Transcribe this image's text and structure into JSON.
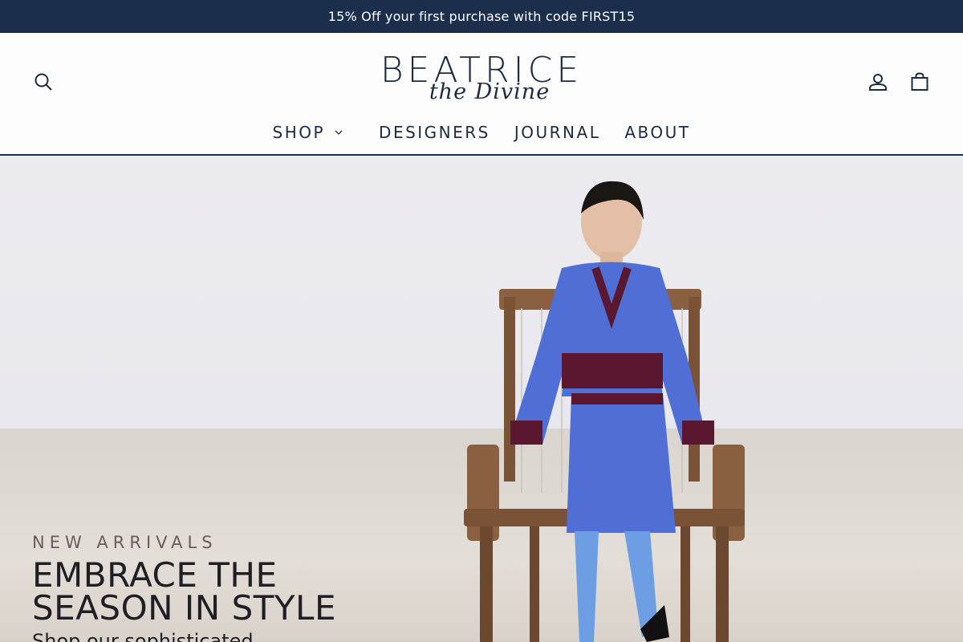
{
  "announcement": "15% Off your first purchase with code FIRST15",
  "brand": {
    "name": "BEATRICE",
    "tagline": "the Divine"
  },
  "header_icons": {
    "search": "search-icon",
    "account": "account-icon",
    "cart": "cart-icon"
  },
  "nav": {
    "items": [
      {
        "label": "SHOP",
        "has_dropdown": true
      },
      {
        "label": "DESIGNERS",
        "has_dropdown": false
      },
      {
        "label": "JOURNAL",
        "has_dropdown": false
      },
      {
        "label": "ABOUT",
        "has_dropdown": false
      }
    ]
  },
  "hero": {
    "eyebrow": "NEW ARRIVALS",
    "headline_line1": "EMBRACE THE",
    "headline_line2": "SEASON IN STYLE",
    "subline": "Shop our sophisticated"
  },
  "colors": {
    "announcement_bg": "#1b2e4b",
    "brand_navy": "#1c2b42",
    "cardigan_blue": "#4f6fd6",
    "cardigan_trim": "#5a1830"
  }
}
